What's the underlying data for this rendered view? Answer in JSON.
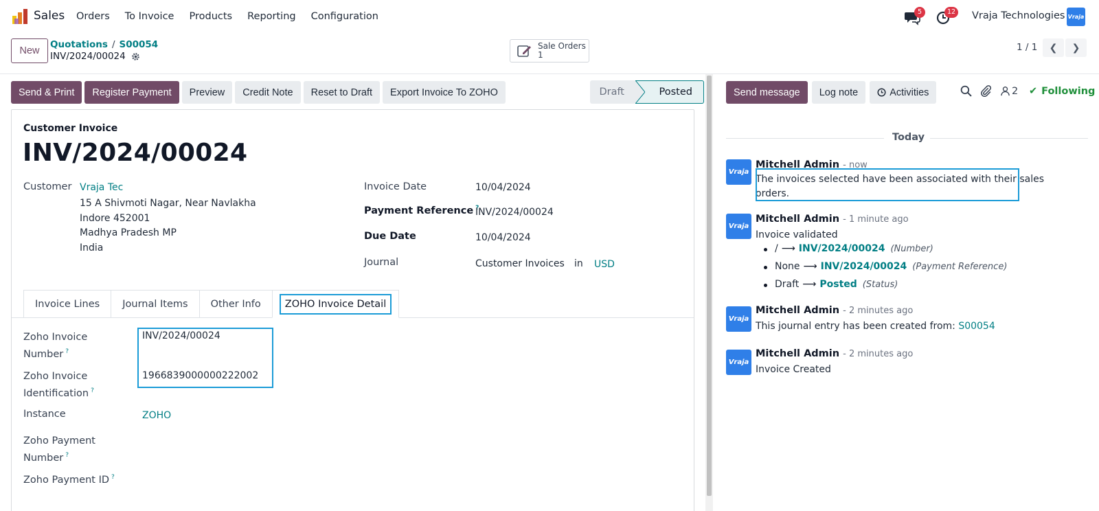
{
  "navbar": {
    "app_name": "Sales",
    "menu": [
      "Orders",
      "To Invoice",
      "Products",
      "Reporting",
      "Configuration"
    ],
    "messages_badge": "5",
    "activities_badge": "12",
    "company": "Vraja Technologies",
    "company_logo_text": "Vraja"
  },
  "control": {
    "new_label": "New",
    "breadcrumb": [
      "Quotations",
      "S00054"
    ],
    "record_title": "INV/2024/00024",
    "smart_button": {
      "label": "Sale Orders",
      "count": "1"
    },
    "pager": "1 / 1"
  },
  "actions": [
    "Send & Print",
    "Register Payment",
    "Preview",
    "Credit Note",
    "Reset to Draft",
    "Export Invoice To ZOHO"
  ],
  "statusbar": {
    "draft": "Draft",
    "posted": "Posted"
  },
  "form": {
    "type_label": "Customer Invoice",
    "name": "INV/2024/00024",
    "customer_label": "Customer",
    "customer_name": "Vraja Tec",
    "address": [
      "15 A Shivmoti Nagar, Near Navlakha",
      "Indore 452001",
      "Madhya Pradesh MP",
      "India"
    ],
    "invoice_date_label": "Invoice Date",
    "invoice_date": "10/04/2024",
    "payment_ref_label": "Payment Reference",
    "payment_ref": "INV/2024/00024",
    "due_date_label": "Due Date",
    "due_date": "10/04/2024",
    "journal_label": "Journal",
    "journal": "Customer Invoices",
    "journal_in": "in",
    "currency": "USD",
    "help_mark": "?"
  },
  "tabs": [
    "Invoice Lines",
    "Journal Items",
    "Other Info",
    "ZOHO Invoice Detail"
  ],
  "zoho": {
    "invoice_number_label": [
      "Zoho Invoice",
      "Number"
    ],
    "invoice_number": "INV/2024/00024",
    "invoice_id_label": [
      "Zoho Invoice",
      "Identification"
    ],
    "invoice_id": "1966839000000222002",
    "instance_label": "Instance",
    "instance": "ZOHO",
    "payment_number_label": [
      "Zoho Payment",
      "Number"
    ],
    "payment_id_label": "Zoho Payment ID"
  },
  "chatter": {
    "send_message": "Send message",
    "log_note": "Log note",
    "activities": "Activities",
    "followers_count": "2",
    "following": "Following",
    "today": "Today",
    "messages": [
      {
        "author": "Mitchell Admin",
        "time": "- now",
        "lines": [
          "The invoices selected have been associated with their sales",
          "orders."
        ]
      },
      {
        "author": "Mitchell Admin",
        "time": "- 1 minute ago",
        "body": "Invoice validated",
        "changes": [
          {
            "old": "/",
            "new": "INV/2024/00024",
            "field": "(Number)"
          },
          {
            "old": "None",
            "new": "INV/2024/00024",
            "field": "(Payment Reference)"
          },
          {
            "old": "Draft",
            "new": "Posted",
            "field": "(Status)"
          }
        ]
      },
      {
        "author": "Mitchell Admin",
        "time": "- 2 minutes ago",
        "body": "This journal entry has been created from:",
        "link": "S00054"
      },
      {
        "author": "Mitchell Admin",
        "time": "- 2 minutes ago",
        "body": "Invoice Created"
      }
    ]
  },
  "colors": {
    "brand": "#714b67",
    "link": "#017e84",
    "highlight": "#1a9bd7",
    "badge": "#dc3545",
    "following": "#1f8f3a"
  }
}
